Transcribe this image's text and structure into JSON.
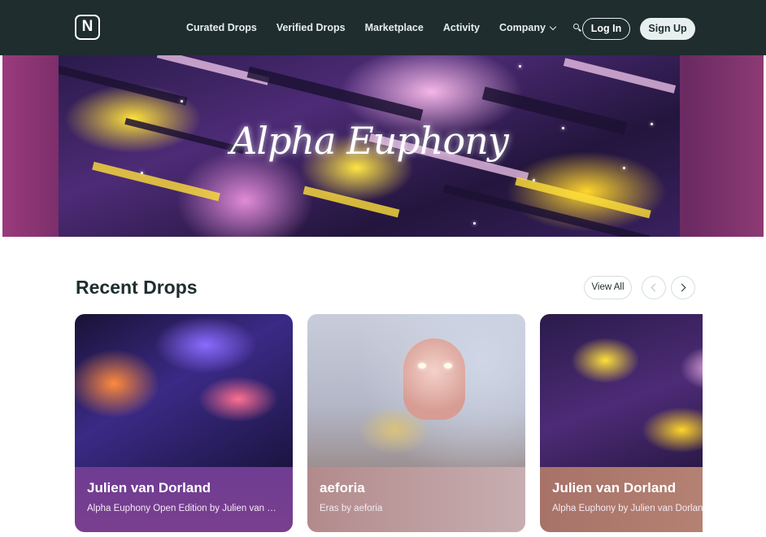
{
  "nav": {
    "logo_letter": "N",
    "links": [
      "Curated Drops",
      "Verified Drops",
      "Marketplace",
      "Activity"
    ],
    "company_label": "Company",
    "login_label": "Log In",
    "signup_label": "Sign Up"
  },
  "hero": {
    "title": "Alpha Euphony"
  },
  "recent": {
    "title": "Recent Drops",
    "view_all_label": "View All",
    "cards": [
      {
        "artist": "Julien van Dorland",
        "subtitle": "Alpha Euphony Open Edition by Julien van Dorland"
      },
      {
        "artist": "aeforia",
        "subtitle": "Eras by aeforia"
      },
      {
        "artist": "Julien van Dorland",
        "subtitle": "Alpha Euphony by Julien van Dorland"
      }
    ]
  },
  "colors": {
    "nav_bg": "#1f2d2e",
    "text_dark": "#1f2d2e",
    "card1_footer": "#6e3d93",
    "card2_footer": "#b38a8c",
    "card3_footer": "#a77268"
  },
  "icons": [
    "logo-icon",
    "chevron-down-icon",
    "search-icon",
    "chevron-left-icon",
    "chevron-right-icon"
  ]
}
